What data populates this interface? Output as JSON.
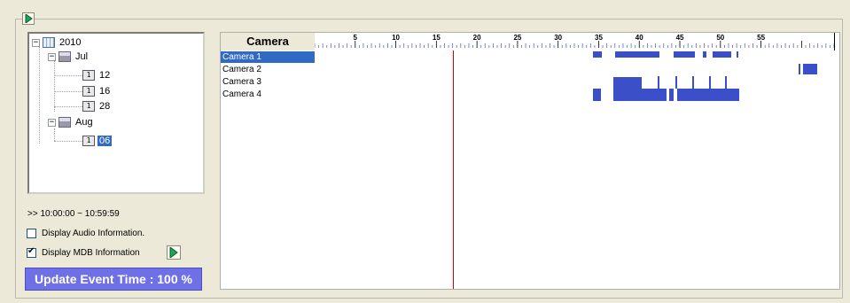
{
  "tree": {
    "year": "2010",
    "months": [
      {
        "label": "Jul",
        "days": [
          "12",
          "16",
          "28"
        ]
      },
      {
        "label": "Aug",
        "days": [
          "06"
        ]
      }
    ],
    "selected_day": "06",
    "day_icon_glyph": "1"
  },
  "time_range": ">> 10:00:00 ~ 10:59:59",
  "options": {
    "audio_label": "Display Audio Information.",
    "audio_checked": false,
    "mdb_label": "Display MDB Information",
    "mdb_checked": true
  },
  "status_text": "Update Event Time : 100 %",
  "timeline": {
    "header": "Camera",
    "ruler_labels": [
      "5",
      "10",
      "15",
      "20",
      "25",
      "30",
      "35",
      "40",
      "45",
      "50",
      "55"
    ],
    "minutes_visible": 64,
    "cursor_minute": 17,
    "cameras": [
      "Camera 1",
      "Camera 2",
      "Camera 3",
      "Camera 4"
    ],
    "selected_camera": "Camera 1",
    "events": [
      {
        "camera": 0,
        "start": 34.3,
        "end": 35.4
      },
      {
        "camera": 0,
        "start": 37.0,
        "end": 42.5
      },
      {
        "camera": 0,
        "start": 44.2,
        "end": 46.8
      },
      {
        "camera": 0,
        "start": 47.8,
        "end": 48.3
      },
      {
        "camera": 0,
        "start": 49.0,
        "end": 51.3
      },
      {
        "camera": 0,
        "start": 52.0,
        "end": 52.2
      },
      {
        "camera": 1,
        "start": 59.6,
        "end": 59.8
      },
      {
        "camera": 1,
        "start": 60.2,
        "end": 61.9
      },
      {
        "camera": 2,
        "start": 36.8,
        "end": 39.0
      },
      {
        "camera": 2,
        "start": 39.0,
        "end": 40.3
      },
      {
        "camera": 2,
        "start": 42.3,
        "end": 42.5
      },
      {
        "camera": 2,
        "start": 44.5,
        "end": 44.7
      },
      {
        "camera": 2,
        "start": 46.5,
        "end": 46.7
      },
      {
        "camera": 2,
        "start": 48.6,
        "end": 48.8
      },
      {
        "camera": 2,
        "start": 50.6,
        "end": 50.8
      },
      {
        "camera": 3,
        "start": 34.3,
        "end": 35.3
      },
      {
        "camera": 3,
        "start": 36.8,
        "end": 43.4
      },
      {
        "camera": 3,
        "start": 43.7,
        "end": 44.2
      },
      {
        "camera": 3,
        "start": 44.7,
        "end": 52.3
      }
    ],
    "event_color": "#3b4fc8",
    "cursor_color": "#d00000"
  }
}
